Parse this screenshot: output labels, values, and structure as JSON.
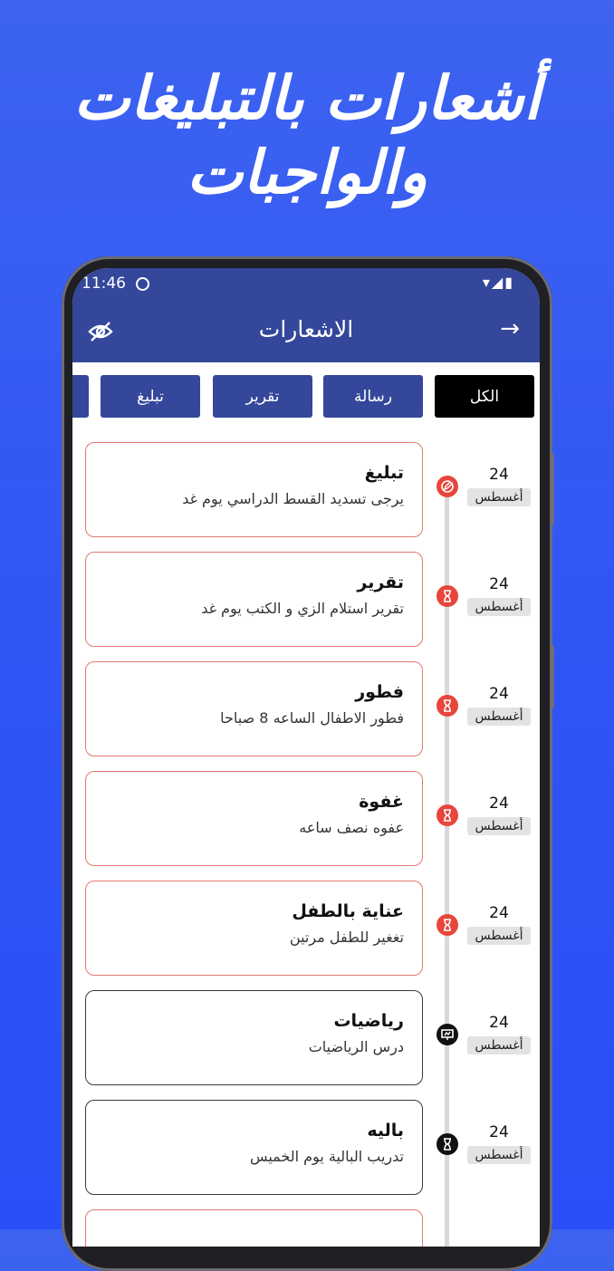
{
  "promo": {
    "line1": "أشعارات بالتبليغات",
    "line2": "والواجبات"
  },
  "status_bar": {
    "time": "11:46",
    "right_icons": "▾◢▮"
  },
  "app_bar": {
    "title": "الاشعارات",
    "back_icon": "arrow-right-icon",
    "eye_icon": "eye-off-icon"
  },
  "tabs": [
    {
      "label": "الكل",
      "active": true
    },
    {
      "label": "رسالة",
      "active": false
    },
    {
      "label": "تقرير",
      "active": false
    },
    {
      "label": "تبليغ",
      "active": false
    },
    {
      "label": "",
      "active": false
    }
  ],
  "notifications": [
    {
      "title": "تبليغ",
      "body": "يرجى تسديد القسط الدراسي يوم غد",
      "day": "24",
      "month": "أغسطس",
      "icon": "edit-icon",
      "style": "red"
    },
    {
      "title": "تقرير",
      "body": "تقرير استلام الزي و الكتب يوم غد",
      "day": "24",
      "month": "أغسطس",
      "icon": "hourglass-icon",
      "style": "red"
    },
    {
      "title": "فطور",
      "body": "فطور الاطفال الساعه 8 صباحا",
      "day": "24",
      "month": "أغسطس",
      "icon": "hourglass-icon",
      "style": "red"
    },
    {
      "title": "غفوة",
      "body": "عفوه نصف ساعه",
      "day": "24",
      "month": "أغسطس",
      "icon": "hourglass-icon",
      "style": "red"
    },
    {
      "title": "عناية بالطفل",
      "body": "تغغير للطفل مرتين",
      "day": "24",
      "month": "أغسطس",
      "icon": "hourglass-icon",
      "style": "red"
    },
    {
      "title": "رياضيات",
      "body": "درس الرياضيات",
      "day": "24",
      "month": "أغسطس",
      "icon": "presentation-icon",
      "style": "dark"
    },
    {
      "title": "باليه",
      "body": "تدريب البالية يوم الخميس",
      "day": "24",
      "month": "أغسطس",
      "icon": "hourglass-icon",
      "style": "dark"
    },
    {
      "title": "",
      "body": "",
      "day": "",
      "month": "",
      "icon": "",
      "style": "red"
    }
  ],
  "colors": {
    "background": "#2f53f5",
    "app_bar": "#34479a",
    "tab_active": "#000000",
    "card_border_red": "#e07a6f",
    "marker_red": "#e8453c"
  }
}
